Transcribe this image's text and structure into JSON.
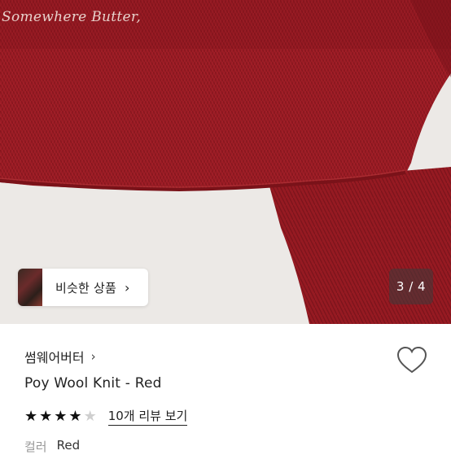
{
  "product_image": {
    "embroidery_text": "Somewhere Butter",
    "colors": {
      "knit": "#9b1b24",
      "knit_dark": "#7f141c",
      "background": "#ece9e6"
    }
  },
  "similar_products": {
    "label": "비슷한 상품",
    "chevron": "›"
  },
  "image_counter": {
    "text": "3 / 4"
  },
  "brand": {
    "name": "썸웨어버터",
    "chevron": "›"
  },
  "product": {
    "title": "Poy Wool Knit - Red",
    "rating": 4,
    "max_rating": 5,
    "review_link": "10개 리뷰 보기"
  },
  "option": {
    "key": "컬러",
    "value": "Red"
  },
  "icons": [
    "heart-icon",
    "star-icon",
    "chevron-right-icon"
  ]
}
